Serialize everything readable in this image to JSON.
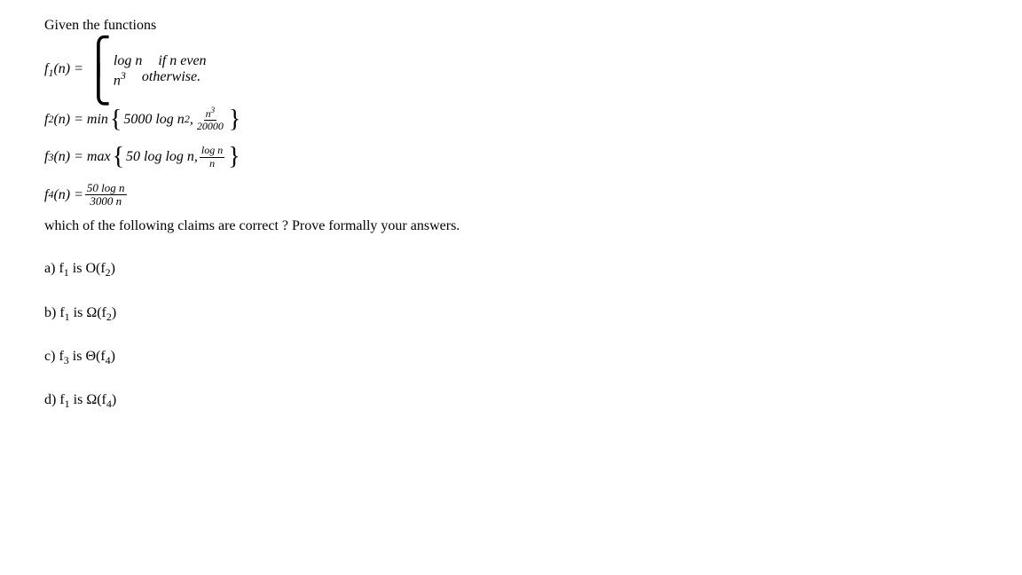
{
  "intro": "Given the functions",
  "f1": {
    "lhs": "f",
    "sub": "1",
    "arg": "(n) = ",
    "case1_val": "log n",
    "case1_cond": "if n even",
    "case2_val_base": "n",
    "case2_val_exp": "3",
    "case2_cond": "otherwise."
  },
  "f2": {
    "lhs": "f",
    "sub": "2",
    "arg": "(n) = min ",
    "part1a": "5000 log n",
    "part1_exp": "2",
    "sep": " , ",
    "frac_num_base": "n",
    "frac_num_exp": "3",
    "frac_den": "20000"
  },
  "f3": {
    "lhs": "f",
    "sub": "3",
    "arg": "(n) = max ",
    "part1": "50 log log n",
    "sep": " , ",
    "frac_num": "log n",
    "frac_den": "n"
  },
  "f4": {
    "lhs": "f",
    "sub": "4",
    "arg": "(n) = ",
    "frac_num": "50 log n",
    "frac_den": "3000 n"
  },
  "question": "which of the following claims are correct ? Prove formally your answers.",
  "options": {
    "a": {
      "label": "a) ",
      "f_left": "f",
      "sub_left": "1",
      "mid": " is O(f",
      "sub_right": "2",
      "end": ")"
    },
    "b": {
      "label": "b)  ",
      "f_left": "f",
      "sub_left": "1",
      "mid": " is Ω(f",
      "sub_right": "2",
      "end": ")"
    },
    "c": {
      "label": "c) ",
      "f_left": "f",
      "sub_left": "3",
      "mid": " is Θ(f",
      "sub_right": "4",
      "end": ")"
    },
    "d": {
      "label": "d)  ",
      "f_left": "f",
      "sub_left": "1",
      "mid": " is Ω(f",
      "sub_right": "4",
      "end": ")"
    }
  }
}
